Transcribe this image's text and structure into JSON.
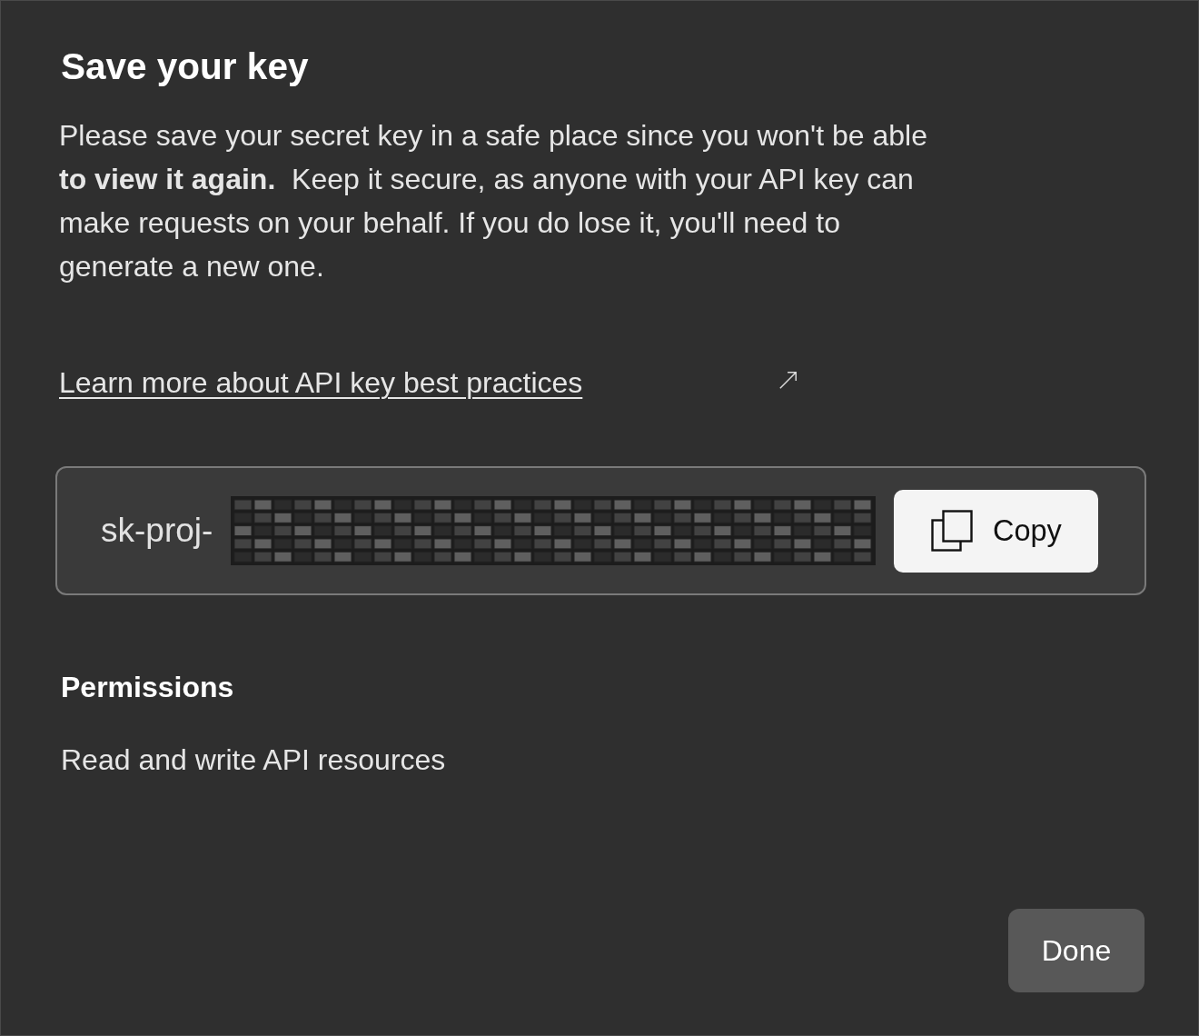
{
  "dialog": {
    "title": "Save your key",
    "message": "Please save your secret key in a safe place since you won't be able **to view it again.**  Keep it secure, as anyone with your API key can make requests on your behalf. If you do lose it, you'll need to generate a new one.",
    "link": {
      "label": "Learn more about API key best practices"
    }
  },
  "key": {
    "prefix": "sk-proj-",
    "copy_button": {
      "label": "Copy"
    }
  },
  "permissions": {
    "heading": "Permissions",
    "value": "Read and write API resources"
  },
  "buttons": [
    {
      "label": "Done"
    }
  ]
}
